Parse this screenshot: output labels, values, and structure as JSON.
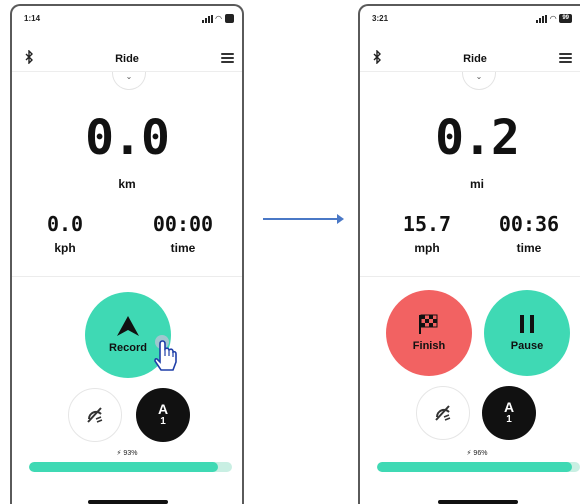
{
  "left": {
    "status_time": "1:14",
    "header_title": "Ride",
    "distance_value": "0.0",
    "distance_unit": "km",
    "speed_value": "0.0",
    "speed_unit": "kph",
    "time_value": "00:00",
    "time_label": "time",
    "record_label": "Record",
    "mode_letter": "A",
    "mode_number": "1",
    "battery_percent_text": "93%",
    "battery_level": 0.93
  },
  "right": {
    "status_time": "3:21",
    "header_title": "Ride",
    "distance_value": "0.2",
    "distance_unit": "mi",
    "speed_value": "15.7",
    "speed_unit": "mph",
    "time_value": "00:36",
    "time_label": "time",
    "finish_label": "Finish",
    "pause_label": "Pause",
    "mode_letter": "A",
    "mode_number": "1",
    "battery_percent_text": "96%",
    "battery_level": 0.96,
    "status_battery": "99"
  },
  "icons": {
    "bluetooth": "bluetooth-icon",
    "menu": "hamburger-menu-icon",
    "record": "navigation-arrow-icon",
    "finish": "checkered-flag-icon",
    "pause": "pause-icon",
    "assist": "assist-off-icon",
    "battery": "lightning-icon",
    "cursor": "hand-pointer-icon"
  },
  "colors": {
    "accent_green": "#3fd9b4",
    "finish_red": "#f26262",
    "progress_track": "#c9efe3",
    "arrow_blue": "#4a78c6",
    "mode_black": "#111111"
  }
}
